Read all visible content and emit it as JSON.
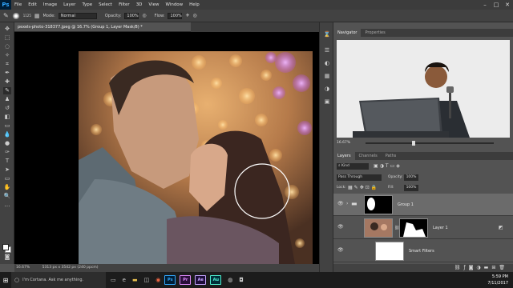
{
  "app": {
    "logo": "Ps",
    "menu": [
      "File",
      "Edit",
      "Image",
      "Layer",
      "Type",
      "Select",
      "Filter",
      "3D",
      "View",
      "Window",
      "Help"
    ]
  },
  "options": {
    "brush_size": "1125",
    "mode_label": "Mode:",
    "mode_value": "Normal",
    "opacity_label": "Opacity:",
    "opacity_value": "100%",
    "flow_label": "Flow:",
    "flow_value": "100%"
  },
  "document": {
    "tab_title": "pexels-photo-318377.jpeg @ 16.7% (Group 1, Layer Mask/8) *",
    "status": "16.67%",
    "status_doc": "5313 px x 3542 px (240 ppcm)"
  },
  "navigator": {
    "tabs": [
      "Navigator",
      "Properties"
    ],
    "zoom": "16.67%"
  },
  "layers": {
    "tabs": [
      "Layers",
      "Channels",
      "Paths"
    ],
    "kind_label": "Kind",
    "blend_mode": "Pass Through",
    "opacity_label": "Opacity:",
    "opacity_value": "100%",
    "lock_label": "Lock:",
    "fill_label": "Fill:",
    "fill_value": "100%",
    "items": [
      {
        "name": "Group 1"
      },
      {
        "name": "Layer 1"
      },
      {
        "name": "Smart Filters"
      }
    ]
  },
  "taskbar": {
    "cortana_text": "I'm Cortana. Ask me anything.",
    "apps": [
      {
        "label": "Ps",
        "bg": "#001e36",
        "fg": "#31a8ff"
      },
      {
        "label": "Pr",
        "bg": "#2a0f3a",
        "fg": "#e08bff"
      },
      {
        "label": "Ae",
        "bg": "#1e0e3a",
        "fg": "#c4a4ff"
      },
      {
        "label": "Au",
        "bg": "#00303a",
        "fg": "#4ff2d2"
      }
    ],
    "time": "5:59 PM",
    "date": "7/11/2017"
  }
}
